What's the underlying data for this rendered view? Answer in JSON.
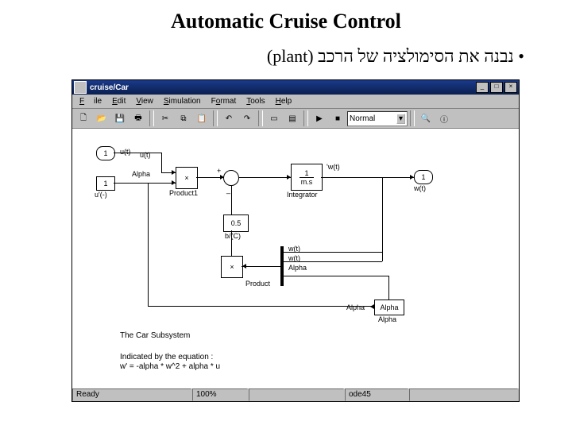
{
  "slide": {
    "title": "Automatic Cruise Control",
    "bullet": "נבנה את הסימולציה של הרכב (plant)"
  },
  "window": {
    "title": "cruise/Car",
    "min": "_",
    "max": "□",
    "close": "×"
  },
  "menu": {
    "file": "File",
    "edit": "Edit",
    "view": "View",
    "simulation": "Simulation",
    "format": "Format",
    "tools": "Tools",
    "help": "Help"
  },
  "toolbar": {
    "mode": "Normal"
  },
  "blocks": {
    "const1": "1",
    "const1_name": "u'(-)",
    "product1": "Product1",
    "product": "Product",
    "gain05": "0.5",
    "gainlabel": "b/(C)",
    "integrator_num": "1",
    "integrator_den": "m.s",
    "integrator_name": "Integrator",
    "alpha_box": "Alpha",
    "alpha_label": "Alpha",
    "alpha_label2": "Alpha",
    "out1": "1",
    "out1_name": "u(t)",
    "sig_ut": "u(t)",
    "sig_alpha": "Alpha",
    "sig_wt": "'w(t)",
    "sig_w1": "w(t)",
    "sig_w2": "w(t)",
    "sig_w3": "w(t)",
    "mux_alpha": "Alpha",
    "sum_plus": "+",
    "sum_minus": "_",
    "subsys_title": "The Car Subsystem",
    "equation1": "Indicated by the equation :",
    "equation2": "w' = -alpha * w^2 + alpha * u"
  },
  "status": {
    "ready": "Ready",
    "zoom": "100%",
    "solver": "ode45"
  }
}
